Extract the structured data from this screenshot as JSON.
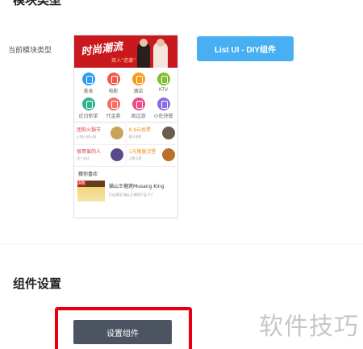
{
  "section1": {
    "title": "模块类型"
  },
  "module_type": {
    "label": "当前模块类型",
    "button_label": "List UI - DIY组件"
  },
  "preview": {
    "banner_text": "时尚潮流",
    "banner_tag": "双人“逆袭”",
    "icons": [
      {
        "label": "美食",
        "color": "#2f9df2"
      },
      {
        "label": "电影",
        "color": "#f05a4a"
      },
      {
        "label": "酒店",
        "color": "#f59b1d"
      },
      {
        "label": "KTV",
        "color": "#7fc12d"
      },
      {
        "label": "近日新单",
        "color": "#30b48d"
      },
      {
        "label": "代金券",
        "color": "#f37063"
      },
      {
        "label": "周边游",
        "color": "#e94e8d"
      },
      {
        "label": "小吃快餐",
        "color": "#8b6ce6"
      }
    ],
    "promos": [
      {
        "title": "团购火锅节",
        "sub": "火锅火锅火锅",
        "pic_color": "#c9a35c"
      },
      {
        "title": "9.9元抢票",
        "sub": "看好电影",
        "pic_color": "#6b5c4e"
      },
      {
        "title": "很哥爱的人",
        "sub": "找个合适",
        "pic_color": "#5a4a8a"
      },
      {
        "title": "1元限量汉堡",
        "sub": "汉堡汉堡",
        "pic_color": "#b8702a"
      }
    ],
    "guess_header": "猜你喜欢",
    "guess_badge": "实物",
    "guess_name": "猫山王榴莲Musang King",
    "guess_desc": "[1店通用] 猫山王榴莲千层 5寸"
  },
  "section2": {
    "title": "组件设置"
  },
  "settings": {
    "button_label": "设置组件"
  },
  "watermark": "软件技巧"
}
